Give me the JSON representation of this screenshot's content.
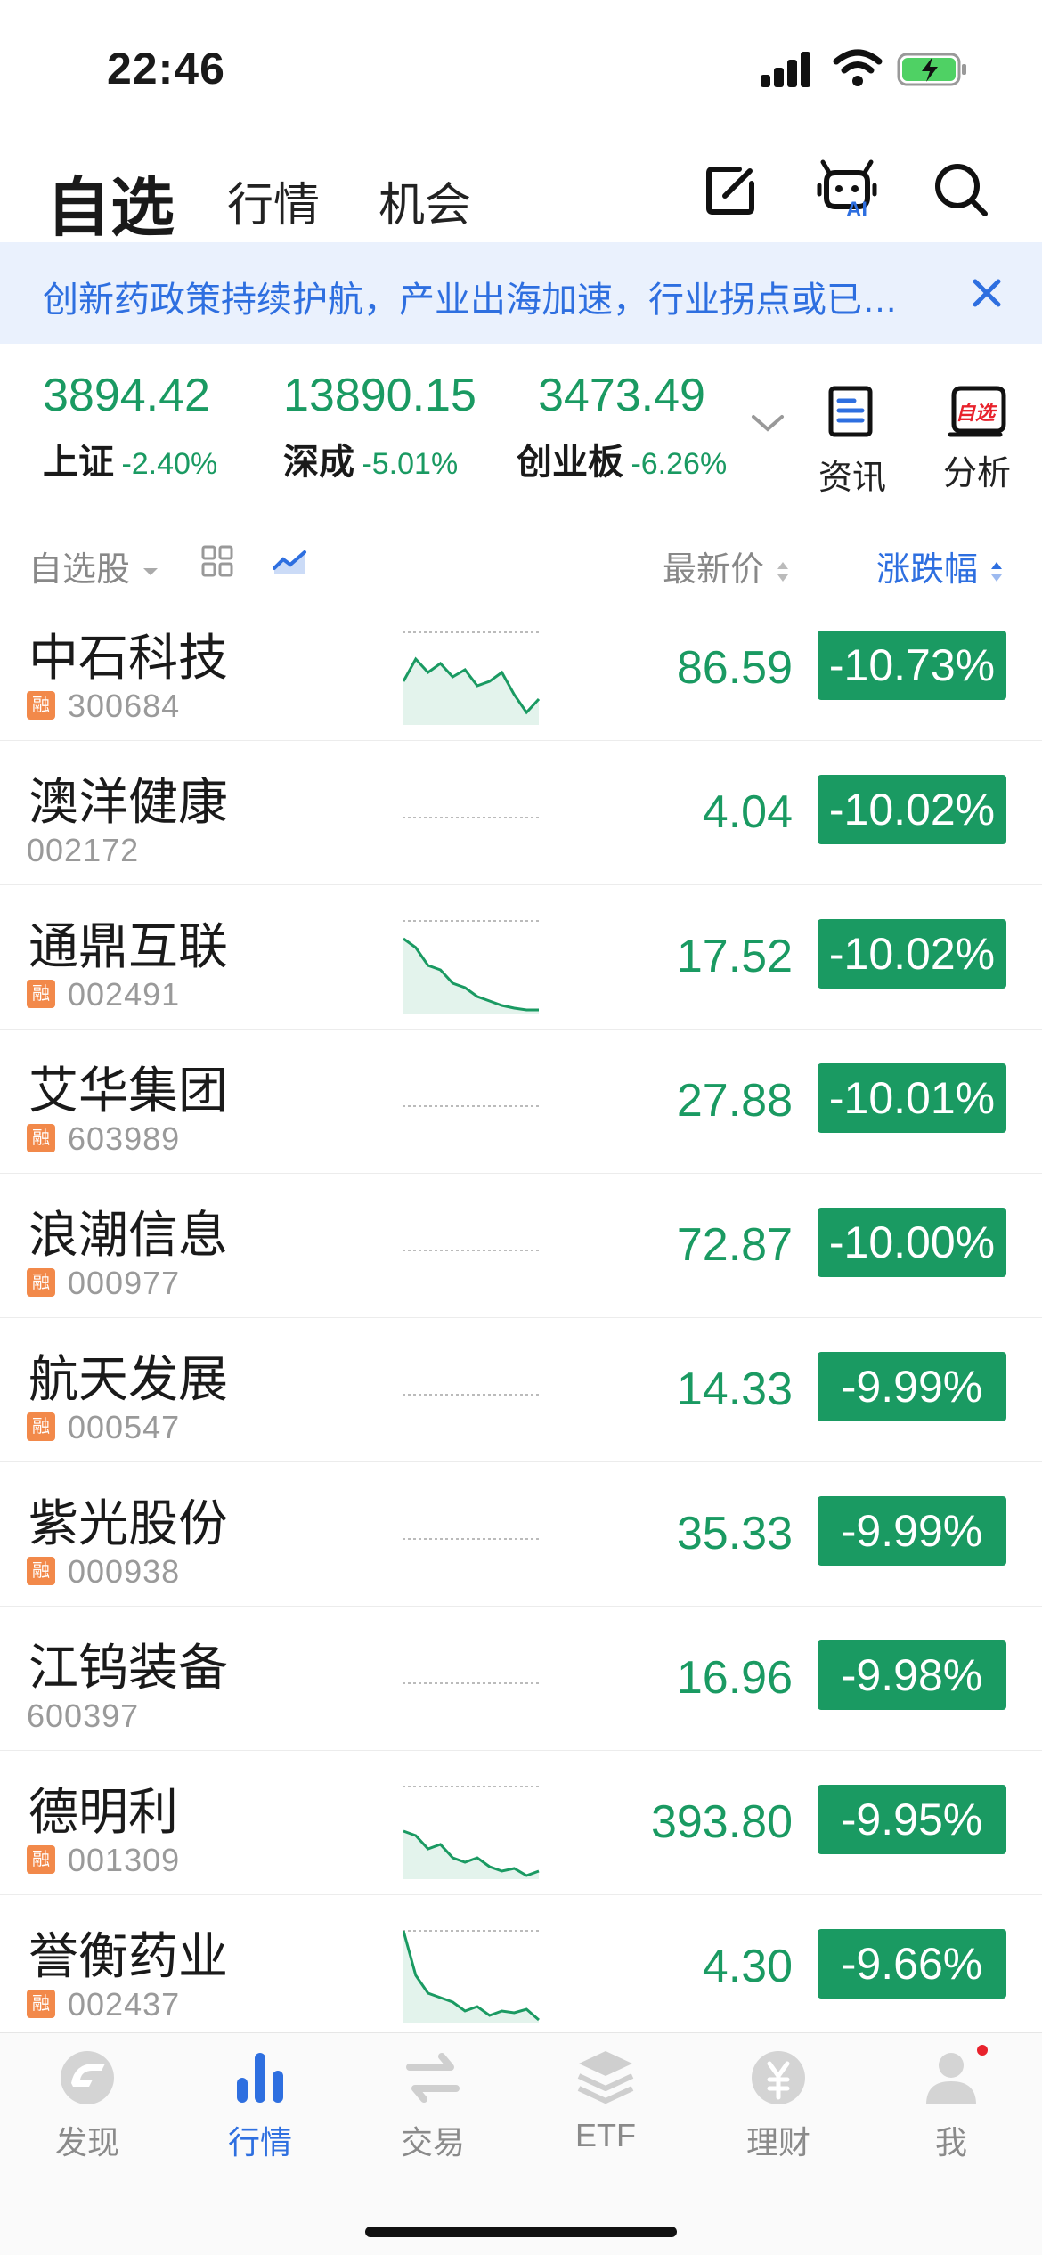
{
  "status_bar": {
    "time": "22:46"
  },
  "header": {
    "tabs": [
      {
        "label": "自选",
        "active": true
      },
      {
        "label": "行情"
      },
      {
        "label": "机会"
      }
    ],
    "icons": [
      "edit-icon",
      "ai-robot-icon",
      "search-icon"
    ],
    "ai_badge": "AI"
  },
  "banner": {
    "text": "创新药政策持续护航，产业出海加速，行业拐点或已…"
  },
  "indices": [
    {
      "value": "3894.42",
      "name": "上证",
      "change": "-2.40%"
    },
    {
      "value": "13890.15",
      "name": "深成",
      "change": "-5.01%"
    },
    {
      "value": "3473.49",
      "name": "创业板",
      "change": "-6.26%"
    }
  ],
  "tools": [
    {
      "label": "资讯",
      "icon": "news-icon"
    },
    {
      "label": "分析",
      "icon": "analysis-icon",
      "badge": "自选"
    }
  ],
  "list_header": {
    "group": "自选股",
    "price_col": "最新价",
    "change_col": "涨跌幅"
  },
  "stocks": [
    {
      "name": "中石科技",
      "code": "300684",
      "margin": true,
      "price": "86.59",
      "change": "-10.73%",
      "spark": [
        0.55,
        0.3,
        0.45,
        0.35,
        0.5,
        0.42,
        0.6,
        0.55,
        0.45,
        0.7,
        0.9,
        0.75
      ]
    },
    {
      "name": "澳洋健康",
      "code": "002172",
      "margin": false,
      "price": "4.04",
      "change": "-10.02%",
      "spark": null
    },
    {
      "name": "通鼎互联",
      "code": "002491",
      "margin": true,
      "price": "17.52",
      "change": "-10.02%",
      "spark": [
        0.2,
        0.3,
        0.5,
        0.55,
        0.7,
        0.75,
        0.85,
        0.9,
        0.95,
        0.98,
        1,
        1
      ]
    },
    {
      "name": "艾华集团",
      "code": "603989",
      "margin": true,
      "price": "27.88",
      "change": "-10.01%",
      "spark": null
    },
    {
      "name": "浪潮信息",
      "code": "000977",
      "margin": true,
      "price": "72.87",
      "change": "-10.00%",
      "spark": null
    },
    {
      "name": "航天发展",
      "code": "000547",
      "margin": true,
      "price": "14.33",
      "change": "-9.99%",
      "spark": null
    },
    {
      "name": "紫光股份",
      "code": "000938",
      "margin": true,
      "price": "35.33",
      "change": "-9.99%",
      "spark": null
    },
    {
      "name": "江钨装备",
      "code": "600397",
      "margin": false,
      "price": "16.96",
      "change": "-9.98%",
      "spark": null
    },
    {
      "name": "德明利",
      "code": "001309",
      "margin": true,
      "price": "393.80",
      "change": "-9.95%",
      "spark": [
        0.5,
        0.55,
        0.7,
        0.65,
        0.8,
        0.85,
        0.8,
        0.9,
        0.95,
        0.92,
        1,
        0.95
      ]
    },
    {
      "name": "誉衡药业",
      "code": "002437",
      "margin": true,
      "price": "4.30",
      "change": "-9.66%",
      "spark": [
        0.0,
        0.5,
        0.7,
        0.75,
        0.8,
        0.9,
        0.85,
        0.95,
        0.9,
        0.92,
        0.88,
        1
      ]
    }
  ],
  "margin_badge": "融",
  "bottom_nav": [
    {
      "label": "发现",
      "icon": "discover-icon"
    },
    {
      "label": "行情",
      "icon": "market-icon",
      "active": true
    },
    {
      "label": "交易",
      "icon": "trade-icon"
    },
    {
      "label": "ETF",
      "icon": "etf-icon"
    },
    {
      "label": "理财",
      "icon": "wealth-icon"
    },
    {
      "label": "我",
      "icon": "profile-icon",
      "notification_dot": true
    }
  ],
  "colors": {
    "down_green": "#1a9a62",
    "accent_blue": "#2e6fe0",
    "banner_bg": "#eaf1fd",
    "margin_badge": "#f2894a",
    "notification_red": "#e8222c"
  }
}
